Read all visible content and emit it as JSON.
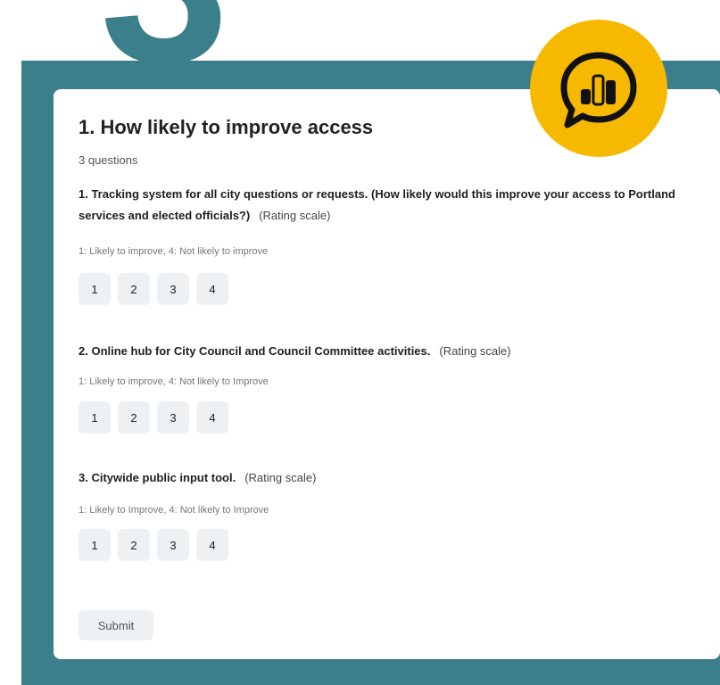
{
  "survey": {
    "title": "1. How likely to improve access",
    "question_count": "3 questions",
    "questions": [
      {
        "text": "1. Tracking system for all city questions or requests. (How likely would this improve your access to Portland services and elected officials?)",
        "type": "(Rating scale)",
        "scale": "1: Likely to improve, 4: Not likely to improve",
        "options": [
          "1",
          "2",
          "3",
          "4"
        ]
      },
      {
        "text": "2. Online hub for City Council and Council Committee activities.",
        "type": "(Rating scale)",
        "scale": "1: Likely to improve, 4: Not likely to Improve",
        "options": [
          "1",
          "2",
          "3",
          "4"
        ]
      },
      {
        "text": "3. Citywide public input tool.",
        "type": "(Rating scale)",
        "scale": "1: Likely to Improve, 4: Not likely to Improve",
        "options": [
          "1",
          "2",
          "3",
          "4"
        ]
      }
    ],
    "submit_label": "Submit"
  },
  "decor": {
    "big_digit": "3",
    "badge_icon": "poll-speech-bubble-icon"
  },
  "colors": {
    "frame": "#3b7f8a",
    "badge": "#f6b900",
    "button_bg": "#eef1f4"
  }
}
